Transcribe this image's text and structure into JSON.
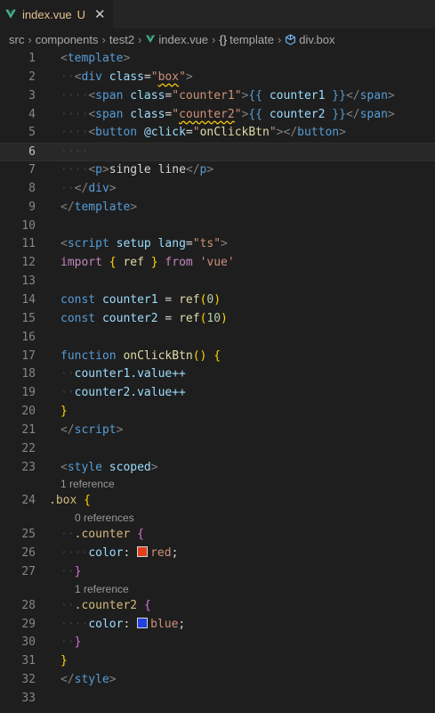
{
  "tab": {
    "filename": "index.vue",
    "status": "U"
  },
  "breadcrumb": [
    "src",
    "components",
    "test2",
    "index.vue",
    "template",
    "div.box"
  ],
  "lenses": {
    "box": "1 reference",
    "counter": "0 references",
    "counter2": "1 reference"
  },
  "colors": {
    "red_swatch": "#e2401c",
    "blue_swatch": "#2040e0"
  },
  "lines": [
    "1",
    "2",
    "3",
    "4",
    "5",
    "6",
    "7",
    "8",
    "9",
    "10",
    "11",
    "12",
    "13",
    "14",
    "15",
    "16",
    "17",
    "18",
    "19",
    "20",
    "21",
    "22",
    "23",
    "24",
    "25",
    "26",
    "27",
    "28",
    "29",
    "30",
    "31",
    "32",
    "33"
  ],
  "code": {
    "l1_tag": "template",
    "l2_tag": "div",
    "l2_attr": "class",
    "l2_val": "box",
    "l3_tag": "span",
    "l3_attr": "class",
    "l3_val": "counter1",
    "l3_expr": "counter1",
    "l3_close": "span",
    "l4_tag": "span",
    "l4_attr": "class",
    "l4_val": "counter2",
    "l4_expr": "counter2",
    "l4_close": "span",
    "l5_tag": "button",
    "l5_attr": "@click",
    "l5_val": "onClickBtn",
    "l5_close": "button",
    "l7_tag": "p",
    "l7_text": "single line",
    "l7_close": "p",
    "l8_close": "div",
    "l9_close": "template",
    "l11_tag": "script",
    "l11_attr1": "setup",
    "l11_attr2": "lang",
    "l11_val": "ts",
    "l12_kw": "import",
    "l12_name": "ref",
    "l12_from": "from",
    "l12_mod": "'vue'",
    "l14_kw": "const",
    "l14_var": "counter1",
    "l14_fn": "ref",
    "l14_num": "0",
    "l15_kw": "const",
    "l15_var": "counter2",
    "l15_fn": "ref",
    "l15_num": "10",
    "l17_kw": "function",
    "l17_fn": "onClickBtn",
    "l18_text": "counter1.value++",
    "l19_text": "counter2.value++",
    "l21_close": "script",
    "l23_tag": "style",
    "l23_attr": "scoped",
    "l24_sel": ".box",
    "l25_sel": ".counter",
    "l26_prop": "color",
    "l26_val": "red",
    "l28_sel": ".counter2",
    "l29_prop": "color",
    "l29_val": "blue",
    "l32_close": "style"
  }
}
